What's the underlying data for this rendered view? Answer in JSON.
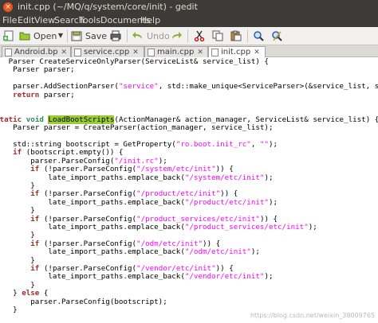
{
  "window": {
    "title": "init.cpp (~/MQ/q/system/core/init) - gedit",
    "close_glyph": "×"
  },
  "menu": [
    "File",
    "Edit",
    "View",
    "Search",
    "Tools",
    "Documents",
    "Help"
  ],
  "toolbar": {
    "new_icon": "new-document-icon",
    "open_label": "Open",
    "save_label": "Save",
    "print_icon": "print-icon",
    "undo_label": "Undo",
    "redo_icon": "redo-icon",
    "cut_icon": "cut-icon",
    "copy_icon": "copy-icon",
    "paste_icon": "paste-icon",
    "find_icon": "find-icon",
    "replace_icon": "replace-icon"
  },
  "tabs": [
    {
      "label": "Android.bp",
      "active": false
    },
    {
      "label": "service.cpp",
      "active": false
    },
    {
      "label": "main.cpp",
      "active": false
    },
    {
      "label": "init.cpp",
      "active": true
    }
  ],
  "highlight_color": "#9acd32",
  "keyword_color": "#a52a2a",
  "type_color": "#2e8b57",
  "string_color": "#ff00ff",
  "code_lines": [
    [
      [
        "t",
        "   Parser CreateServiceOnlyParser(ServiceList& service_list) {"
      ]
    ],
    [
      [
        "t",
        "    Parser parser;"
      ]
    ],
    [
      [
        "t",
        ""
      ]
    ],
    [
      [
        "t",
        "    parser.AddSectionParser("
      ],
      [
        "s",
        "\"service\""
      ],
      [
        "t",
        ", std::make_unique<ServiceParser>(&service_list, subc"
      ]
    ],
    [
      [
        "t",
        "    "
      ],
      [
        "k",
        "return"
      ],
      [
        "t",
        " parser;"
      ]
    ],
    [
      [
        "t",
        "}"
      ]
    ],
    [
      [
        "t",
        ""
      ]
    ],
    [
      [
        "k",
        "static"
      ],
      [
        "t",
        " "
      ],
      [
        "y",
        "void"
      ],
      [
        "t",
        " "
      ],
      [
        "h",
        "LoadBootScripts"
      ],
      [
        "t",
        "(ActionManager& action_manager, ServiceList& service_list) {"
      ]
    ],
    [
      [
        "t",
        "    Parser parser = CreateParser(action_manager, service_list);"
      ]
    ],
    [
      [
        "t",
        ""
      ]
    ],
    [
      [
        "t",
        "    std::string bootscript = GetProperty("
      ],
      [
        "s",
        "\"ro.boot.init_rc\""
      ],
      [
        "t",
        ", "
      ],
      [
        "s",
        "\"\""
      ],
      [
        "t",
        ");"
      ]
    ],
    [
      [
        "t",
        "    "
      ],
      [
        "k",
        "if"
      ],
      [
        "t",
        " (bootscript.empty()) {"
      ]
    ],
    [
      [
        "t",
        "        parser.ParseConfig("
      ],
      [
        "s",
        "\"/init.rc\""
      ],
      [
        "t",
        ");"
      ]
    ],
    [
      [
        "t",
        "        "
      ],
      [
        "k",
        "if"
      ],
      [
        "t",
        " (!parser.ParseConfig("
      ],
      [
        "s",
        "\"/system/etc/init\""
      ],
      [
        "t",
        ")) {"
      ]
    ],
    [
      [
        "t",
        "            late_import_paths.emplace_back("
      ],
      [
        "s",
        "\"/system/etc/init\""
      ],
      [
        "t",
        ");"
      ]
    ],
    [
      [
        "t",
        "        }"
      ]
    ],
    [
      [
        "t",
        "        "
      ],
      [
        "k",
        "if"
      ],
      [
        "t",
        " (!parser.ParseConfig("
      ],
      [
        "s",
        "\"/product/etc/init\""
      ],
      [
        "t",
        ")) {"
      ]
    ],
    [
      [
        "t",
        "            late_import_paths.emplace_back("
      ],
      [
        "s",
        "\"/product/etc/init\""
      ],
      [
        "t",
        ");"
      ]
    ],
    [
      [
        "t",
        "        }"
      ]
    ],
    [
      [
        "t",
        "        "
      ],
      [
        "k",
        "if"
      ],
      [
        "t",
        " (!parser.ParseConfig("
      ],
      [
        "s",
        "\"/product_services/etc/init\""
      ],
      [
        "t",
        ")) {"
      ]
    ],
    [
      [
        "t",
        "            late_import_paths.emplace_back("
      ],
      [
        "s",
        "\"/product_services/etc/init\""
      ],
      [
        "t",
        ");"
      ]
    ],
    [
      [
        "t",
        "        }"
      ]
    ],
    [
      [
        "t",
        "        "
      ],
      [
        "k",
        "if"
      ],
      [
        "t",
        " (!parser.ParseConfig("
      ],
      [
        "s",
        "\"/odm/etc/init\""
      ],
      [
        "t",
        ")) {"
      ]
    ],
    [
      [
        "t",
        "            late_import_paths.emplace_back("
      ],
      [
        "s",
        "\"/odm/etc/init\""
      ],
      [
        "t",
        ");"
      ]
    ],
    [
      [
        "t",
        "        }"
      ]
    ],
    [
      [
        "t",
        "        "
      ],
      [
        "k",
        "if"
      ],
      [
        "t",
        " (!parser.ParseConfig("
      ],
      [
        "s",
        "\"/vendor/etc/init\""
      ],
      [
        "t",
        ")) {"
      ]
    ],
    [
      [
        "t",
        "            late_import_paths.emplace_back("
      ],
      [
        "s",
        "\"/vendor/etc/init\""
      ],
      [
        "t",
        ");"
      ]
    ],
    [
      [
        "t",
        "        }"
      ]
    ],
    [
      [
        "t",
        "    } "
      ],
      [
        "k",
        "else"
      ],
      [
        "t",
        " {"
      ]
    ],
    [
      [
        "t",
        "        parser.ParseConfig(bootscript);"
      ]
    ],
    [
      [
        "t",
        "    }"
      ]
    ],
    [
      [
        "t",
        "}"
      ]
    ]
  ],
  "watermark": "https://blog.csdn.net/weixin_38009765"
}
